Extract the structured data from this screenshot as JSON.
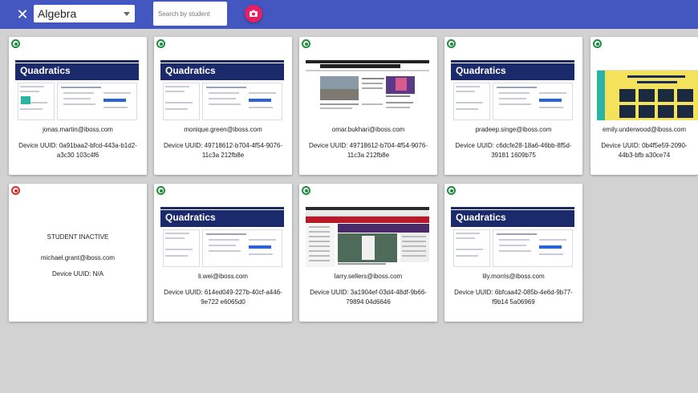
{
  "header": {
    "close_icon": "close-icon",
    "class_name": "Algebra",
    "search_placeholder": "Search by student",
    "camera_icon": "camera-icon",
    "accent": "#4456c0",
    "camera_color": "#e91e63"
  },
  "thumbnail_text": {
    "quadratics_title": "Quadratics"
  },
  "students": [
    {
      "email": "jonas.martin@iboss.com",
      "uuid": "Device UUID: 0a91baa2-bfcd-443a-b1d2-a3c30 103c4f6",
      "status": "online",
      "screen": "quadratics"
    },
    {
      "email": "monique.green@iboss.com",
      "uuid": "Device UUID: 49718612-b704-4f54-9076-11c3a 212fb8e",
      "status": "online",
      "screen": "quadratics"
    },
    {
      "email": "omar.bukhari@iboss.com",
      "uuid": "Device UUID: 49718612-b704-4f54-9076-11c3a 212fb8e",
      "status": "online",
      "screen": "news"
    },
    {
      "email": "pradeep.singe@iboss.com",
      "uuid": "Device UUID: c6dcfe28-18a6-46bb-8f5d-39181 1609b75",
      "status": "online",
      "screen": "quadratics"
    },
    {
      "email": "emily.underwood@iboss.com",
      "uuid": "Device UUID: 0b4f5e59-2090-44b3-bfb a30ce74",
      "status": "online",
      "screen": "game"
    },
    {
      "label": "STUDENT INACTIVE",
      "email": "michael.grant@iboss.com",
      "uuid": "Device UUID: N/A",
      "status": "inactive"
    },
    {
      "email": "li.wei@iboss.com",
      "uuid": "Device UUID: 614ed049-227b-40cf-a446-9e722 e6065d0",
      "status": "online",
      "screen": "quadratics"
    },
    {
      "email": "larry.sellers@iboss.com",
      "uuid": "Device UUID: 3a1904ef-03d4-48df-9b66-79894 04d6646",
      "status": "online",
      "screen": "sports"
    },
    {
      "email": "lily.morris@iboss.com",
      "uuid": "Device UUID: 6bfcaa42-085b-4e6d-9b77-f9b14 5a06969",
      "status": "online",
      "screen": "quadratics"
    }
  ]
}
